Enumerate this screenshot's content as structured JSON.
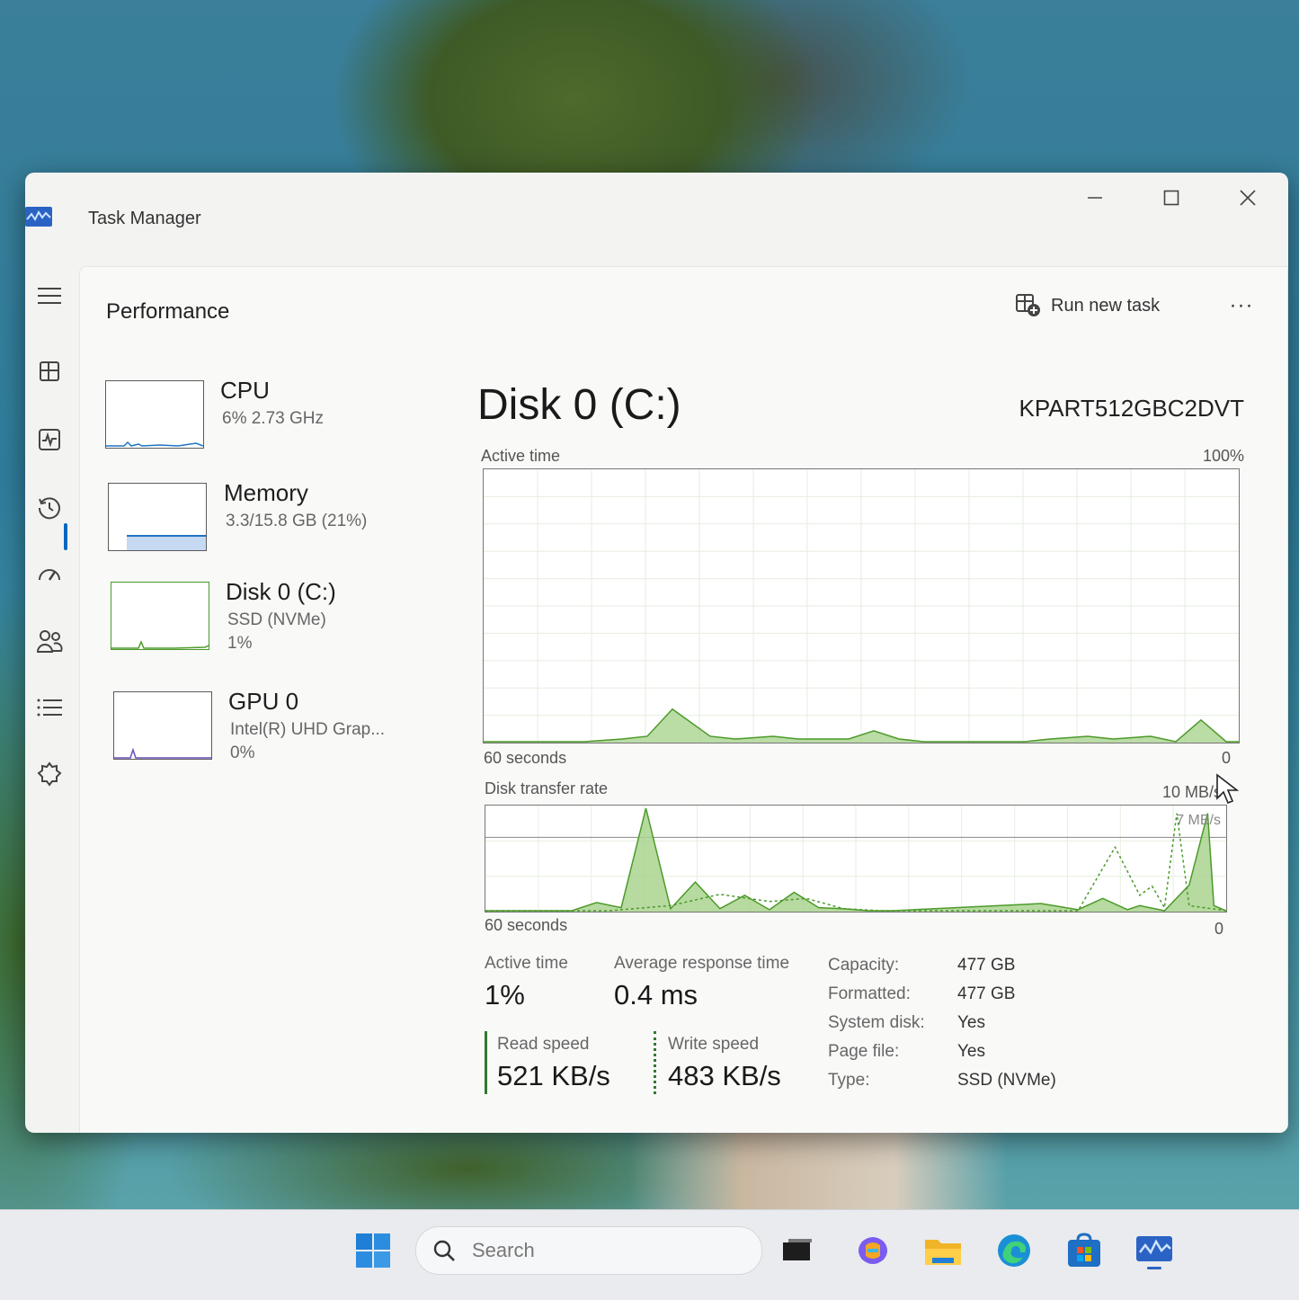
{
  "window": {
    "title": "Task Manager",
    "minimize_glyph": "—",
    "maximize_glyph": "☐",
    "close_glyph": "✕"
  },
  "nav": {
    "items": [
      "hamburger-menu-icon",
      "processes-icon",
      "performance-icon",
      "app-history-icon",
      "startup-apps-icon",
      "users-icon",
      "details-icon",
      "services-icon"
    ],
    "settings": "settings-icon",
    "active": "performance-icon"
  },
  "header": {
    "page_title": "Performance",
    "run_new_task": "Run new task",
    "more": "···"
  },
  "resources": [
    {
      "name": "CPU",
      "sub": "6% 2.73 GHz",
      "sub2": ""
    },
    {
      "name": "Memory",
      "sub": "3.3/15.8 GB (21%)",
      "sub2": ""
    },
    {
      "name": "Disk 0 (C:)",
      "sub": "SSD (NVMe)",
      "sub2": "1%"
    },
    {
      "name": "GPU 0",
      "sub": "Intel(R) UHD Grap...",
      "sub2": "0%"
    }
  ],
  "detail": {
    "title": "Disk 0 (C:)",
    "model": "KPART512GBC2DVT",
    "active_time_graph": {
      "label": "Active time",
      "max_label": "100%",
      "x_left": "60 seconds",
      "x_right": "0"
    },
    "transfer_graph": {
      "label": "Disk transfer rate",
      "max_label": "10 MB/s",
      "mid_label": "7 MB/s",
      "x_left": "60 seconds",
      "x_right": "0"
    },
    "stats": {
      "active_time_label": "Active time",
      "active_time_value": "1%",
      "avg_response_label": "Average response time",
      "avg_response_value": "0.4 ms",
      "read_label": "Read speed",
      "read_value": "521 KB/s",
      "write_label": "Write speed",
      "write_value": "483 KB/s"
    },
    "properties": [
      {
        "key": "Capacity:",
        "value": "477 GB"
      },
      {
        "key": "Formatted:",
        "value": "477 GB"
      },
      {
        "key": "System disk:",
        "value": "Yes"
      },
      {
        "key": "Page file:",
        "value": "Yes"
      },
      {
        "key": "Type:",
        "value": "SSD (NVMe)"
      }
    ]
  },
  "taskbar": {
    "search_placeholder": "Search",
    "icons": [
      "windows-start-icon",
      "task-view-icon",
      "copilot-icon",
      "file-explorer-icon",
      "edge-icon",
      "store-icon",
      "task-manager-icon"
    ]
  },
  "colors": {
    "disk_accent": "#4c9a2a",
    "disk_fill": "#a9d38e",
    "cpu_accent": "#1e74c4",
    "gpu_accent": "#6a4fc0",
    "nav_indicator": "#0067c0"
  },
  "chart_data": [
    {
      "type": "area",
      "title": "Active time",
      "ylim": [
        0,
        100
      ],
      "x": [
        60,
        52,
        49,
        47,
        45,
        42,
        40,
        37,
        35,
        31,
        29,
        27,
        25,
        22,
        20,
        17,
        15,
        12,
        10,
        7,
        5,
        3,
        1,
        0
      ],
      "values": [
        0,
        0,
        1,
        2,
        12,
        2,
        1,
        2,
        1,
        1,
        4,
        1,
        0,
        0,
        0,
        0,
        1,
        2,
        1,
        2,
        0,
        8,
        0,
        0
      ]
    },
    {
      "type": "line",
      "title": "Disk transfer rate",
      "ylim": [
        0,
        10
      ],
      "series": [
        {
          "name": "Read speed",
          "x": [
            60,
            53,
            51,
            49,
            47,
            45,
            43,
            41,
            39,
            37,
            35,
            33,
            31,
            29,
            27,
            15,
            12,
            10,
            8,
            7,
            5,
            3,
            1.5,
            1,
            0
          ],
          "values": [
            0,
            0,
            0.8,
            0.3,
            10,
            0.2,
            2.8,
            0.2,
            1.5,
            0.1,
            1.8,
            0.3,
            0.2,
            0,
            0,
            0.7,
            0.1,
            1.2,
            0.1,
            0.5,
            0,
            2.5,
            9.5,
            0.5,
            0
          ]
        },
        {
          "name": "Write speed",
          "x": [
            60,
            50,
            45,
            41,
            37,
            34,
            31,
            28,
            12,
            9,
            7,
            6,
            5,
            4,
            3,
            0
          ],
          "values": [
            0,
            0,
            0.5,
            1.6,
            0.9,
            1.2,
            0.2,
            0,
            0,
            6.2,
            1.5,
            2.4,
            0.3,
            9.5,
            0.5,
            0
          ]
        }
      ]
    }
  ]
}
